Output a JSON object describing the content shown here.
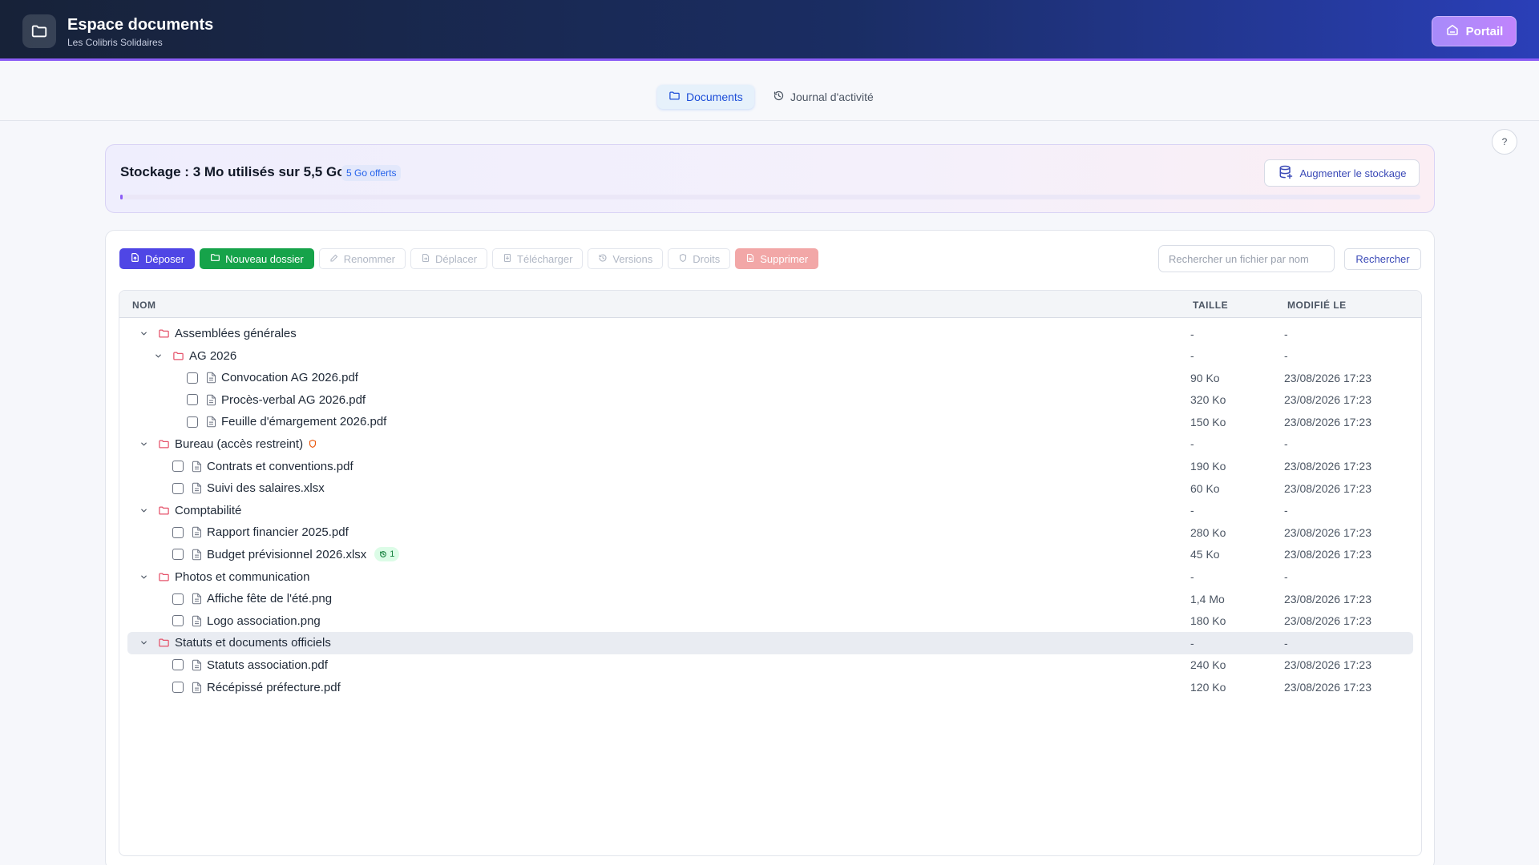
{
  "header": {
    "title": "Espace documents",
    "subtitle": "Les Colibris Solidaires",
    "portal_label": "Portail"
  },
  "tabs": [
    {
      "label": "Documents",
      "active": true
    },
    {
      "label": "Journal d'activité",
      "active": false
    }
  ],
  "help_label": "?",
  "storage": {
    "title": "Stockage : 3 Mo utilisés sur 5,5 Go",
    "badge": "5 Go offerts",
    "upgrade_label": "Augmenter le stockage",
    "usage_fraction": 0.0005
  },
  "toolbar": {
    "upload": "Déposer",
    "new_folder": "Nouveau dossier",
    "rename": "Renommer",
    "move": "Déplacer",
    "download": "Télécharger",
    "versions": "Versions",
    "rights": "Droits",
    "delete": "Supprimer"
  },
  "search": {
    "placeholder": "Rechercher un fichier par nom",
    "button": "Rechercher"
  },
  "table": {
    "headers": {
      "name": "NOM",
      "size": "TAILLE",
      "modified": "MODIFIÉ LE"
    },
    "rows": [
      {
        "type": "folder",
        "depth": 0,
        "name": "Assemblées générales",
        "size": "-",
        "modified": "-"
      },
      {
        "type": "folder",
        "depth": 1,
        "name": "AG 2026",
        "size": "-",
        "modified": "-"
      },
      {
        "type": "file",
        "depth": 2,
        "name": "Convocation AG 2026.pdf",
        "size": "90 Ko",
        "modified": "23/08/2026 17:23"
      },
      {
        "type": "file",
        "depth": 2,
        "name": "Procès-verbal AG 2026.pdf",
        "size": "320 Ko",
        "modified": "23/08/2026 17:23"
      },
      {
        "type": "file",
        "depth": 2,
        "name": "Feuille d'émargement 2026.pdf",
        "size": "150 Ko",
        "modified": "23/08/2026 17:23"
      },
      {
        "type": "folder",
        "depth": 0,
        "name": "Bureau (accès restreint)",
        "restricted": true,
        "size": "-",
        "modified": "-"
      },
      {
        "type": "file",
        "depth": 1,
        "name": "Contrats et conventions.pdf",
        "size": "190 Ko",
        "modified": "23/08/2026 17:23"
      },
      {
        "type": "file",
        "depth": 1,
        "name": "Suivi des salaires.xlsx",
        "size": "60 Ko",
        "modified": "23/08/2026 17:23"
      },
      {
        "type": "folder",
        "depth": 0,
        "name": "Comptabilité",
        "size": "-",
        "modified": "-"
      },
      {
        "type": "file",
        "depth": 1,
        "name": "Rapport financier 2025.pdf",
        "size": "280 Ko",
        "modified": "23/08/2026 17:23"
      },
      {
        "type": "file",
        "depth": 1,
        "name": "Budget prévisionnel 2026.xlsx",
        "versions": "1",
        "size": "45 Ko",
        "modified": "23/08/2026 17:23"
      },
      {
        "type": "folder",
        "depth": 0,
        "name": "Photos et communication",
        "size": "-",
        "modified": "-"
      },
      {
        "type": "file",
        "depth": 1,
        "name": "Affiche fête de l'été.png",
        "size": "1,4 Mo",
        "modified": "23/08/2026 17:23"
      },
      {
        "type": "file",
        "depth": 1,
        "name": "Logo association.png",
        "size": "180 Ko",
        "modified": "23/08/2026 17:23"
      },
      {
        "type": "folder",
        "depth": 0,
        "name": "Statuts et documents officiels",
        "selected": true,
        "size": "-",
        "modified": "-"
      },
      {
        "type": "file",
        "depth": 1,
        "name": "Statuts association.pdf",
        "size": "240 Ko",
        "modified": "23/08/2026 17:23"
      },
      {
        "type": "file",
        "depth": 1,
        "name": "Récépissé préfecture.pdf",
        "size": "120 Ko",
        "modified": "23/08/2026 17:23"
      }
    ]
  },
  "colors": {
    "accent": "#4f46e5",
    "success": "#16a34a",
    "danger": "#f2a7a7",
    "folder": "#e5536b"
  }
}
